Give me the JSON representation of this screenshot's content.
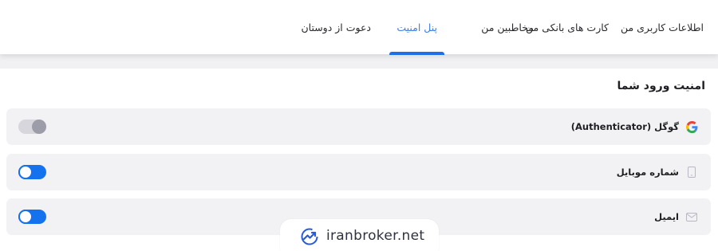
{
  "tabs": [
    {
      "label": "اطلاعات کاربری من",
      "active": false
    },
    {
      "label": "کارت های بانکی من",
      "active": false
    },
    {
      "label": "مخاطبین من",
      "active": false
    },
    {
      "label": "پنل امنیت",
      "active": true
    },
    {
      "label": "دعوت از دوستان",
      "active": false
    }
  ],
  "section_title": "امنیت ورود شما",
  "rows": [
    {
      "label": "گوگل (Authenticator)",
      "icon": "google-icon",
      "toggle": "off"
    },
    {
      "label": "شماره موبایل",
      "icon": "mobile-icon",
      "toggle": "on"
    },
    {
      "label": "ایمیل",
      "icon": "envelope-icon",
      "toggle": "on"
    }
  ],
  "watermark": {
    "text": "iranbroker.net"
  },
  "colors": {
    "accent": "#1572ee",
    "active_tab_text": "#3d7fe0",
    "toggle_off": "#d6d6dc"
  }
}
